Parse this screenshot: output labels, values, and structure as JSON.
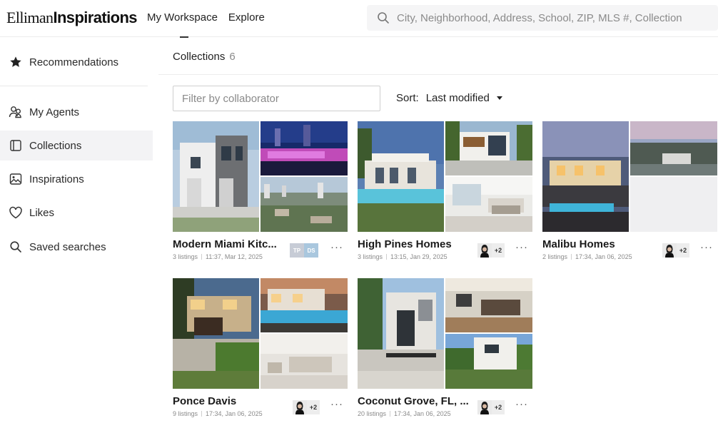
{
  "header": {
    "logo_light": "Elliman",
    "logo_bold": "Inspirations",
    "nav": [
      {
        "label": "My Workspace"
      },
      {
        "label": "Explore"
      }
    ],
    "search_placeholder": "City, Neighborhood, Address, School, ZIP, MLS #, Collection"
  },
  "sidebar": {
    "items": [
      {
        "label": "Recommendations",
        "icon": "star-icon"
      },
      {
        "label": "My Agents",
        "icon": "agents-icon"
      },
      {
        "label": "Collections",
        "icon": "collections-icon"
      },
      {
        "label": "Inspirations",
        "icon": "inspirations-icon"
      },
      {
        "label": "Likes",
        "icon": "heart-icon"
      },
      {
        "label": "Saved searches",
        "icon": "search-icon"
      }
    ]
  },
  "main": {
    "title": "Collections",
    "count": "6",
    "filter_placeholder": "Filter by collaborator",
    "sort_label": "Sort:",
    "sort_value": "Last modified"
  },
  "cards": [
    {
      "name": "Modern Miami Kitc...",
      "listings": "3 listings",
      "modified": "11:37, Mar 12, 2025",
      "initials": [
        "TP",
        "DS"
      ],
      "more": "···"
    },
    {
      "name": "High Pines Homes",
      "listings": "3 listings",
      "modified": "13:15, Jan 29, 2025",
      "plus": "+2",
      "more": "···"
    },
    {
      "name": "Malibu Homes",
      "listings": "2 listings",
      "modified": "17:34, Jan 06, 2025",
      "plus": "+2",
      "more": "···"
    },
    {
      "name": "Ponce Davis",
      "listings": "9 listings",
      "modified": "17:34, Jan 06, 2025",
      "plus": "+2",
      "more": "···"
    },
    {
      "name": "Coconut Grove, FL, ...",
      "listings": "20 listings",
      "modified": "17:34, Jan 06, 2025",
      "plus": "+2",
      "more": "···"
    }
  ],
  "colors": {
    "accent_dark": "#1f1f1f",
    "sidebar_active": "#f3f3f5",
    "initials_tp": "#c7ccd6",
    "initials_ds": "#a9c7de"
  }
}
